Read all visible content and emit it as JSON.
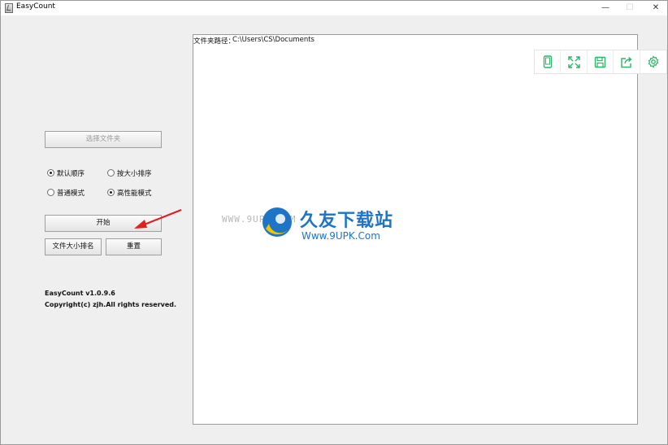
{
  "window": {
    "title": "EasyCount",
    "controls": {
      "minimize": "—",
      "maximize": "☐",
      "close": "✕"
    }
  },
  "left_panel": {
    "choose_folder_button": "选择文件夹",
    "sort_options": [
      {
        "label": "默认顺序",
        "selected": true
      },
      {
        "label": "按大小排序",
        "selected": false
      }
    ],
    "mode_options": [
      {
        "label": "普通模式",
        "selected": false
      },
      {
        "label": "高性能模式",
        "selected": true
      }
    ],
    "start_button": "开始",
    "size_sort_button": "文件大小排名",
    "reset_button": "重置",
    "version": "EasyCount v1.0.9.6",
    "copyright": "Copyright(c) zjh.All rights reserved."
  },
  "content": {
    "path_label": "文件夹路径：",
    "path_value": "C:\\Users\\CS\\Documents"
  },
  "floating_toolbar": {
    "icons": [
      "phone-icon",
      "fullscreen-icon",
      "save-icon",
      "share-icon",
      "settings-icon"
    ],
    "color": "#2fb36b"
  },
  "watermark": {
    "left_text": "WWW.9UPK.COM",
    "title": "久友下载站",
    "url": "Www.9UPK.Com",
    "color": "#1e74c6"
  },
  "annotation": {
    "arrow_color": "#e02020"
  }
}
